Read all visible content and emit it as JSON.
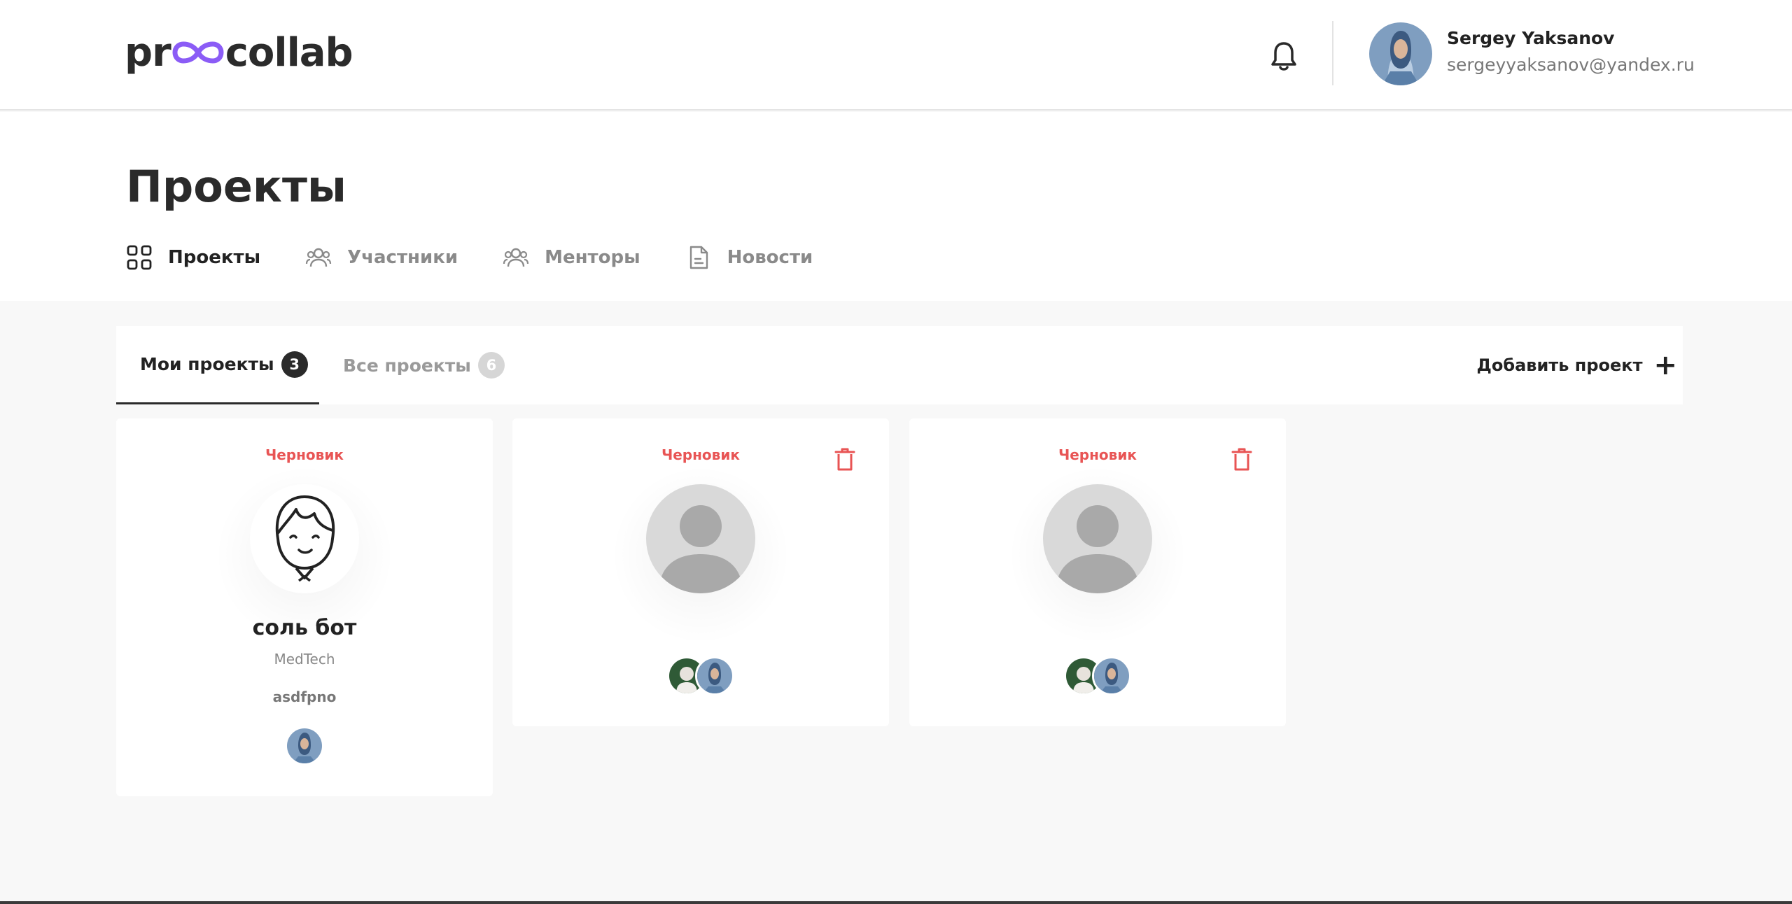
{
  "header": {
    "brand": {
      "prefix": "pr",
      "suffix": "collab",
      "mark_color": "#8b5cf6"
    },
    "user": {
      "name": "Sergey Yaksanov",
      "email": "sergeyyaksanov@yandex.ru"
    }
  },
  "page": {
    "title": "Проекты",
    "nav": [
      {
        "label": "Проекты",
        "icon": "grid-icon",
        "active": true
      },
      {
        "label": "Участники",
        "icon": "users-icon",
        "active": false
      },
      {
        "label": "Менторы",
        "icon": "users-icon",
        "active": false
      },
      {
        "label": "Новости",
        "icon": "document-icon",
        "active": false
      }
    ]
  },
  "tabs": {
    "my": {
      "label": "Мои проекты",
      "count": "3"
    },
    "all": {
      "label": "Все проекты",
      "count": "6"
    },
    "add_label": "Добавить проект",
    "add_icon": "+"
  },
  "cards": [
    {
      "status": "Черновик",
      "name": "соль бот",
      "industry": "MedTech",
      "description": "asdfpno",
      "image": "cartoon-avatar",
      "deletable": false
    },
    {
      "status": "Черновик",
      "image": "placeholder-avatar",
      "deletable": true
    },
    {
      "status": "Черновик",
      "image": "placeholder-avatar",
      "deletable": true
    }
  ],
  "colors": {
    "status": "#e85454",
    "accent": "#8b5cf6",
    "text": "#222222"
  }
}
